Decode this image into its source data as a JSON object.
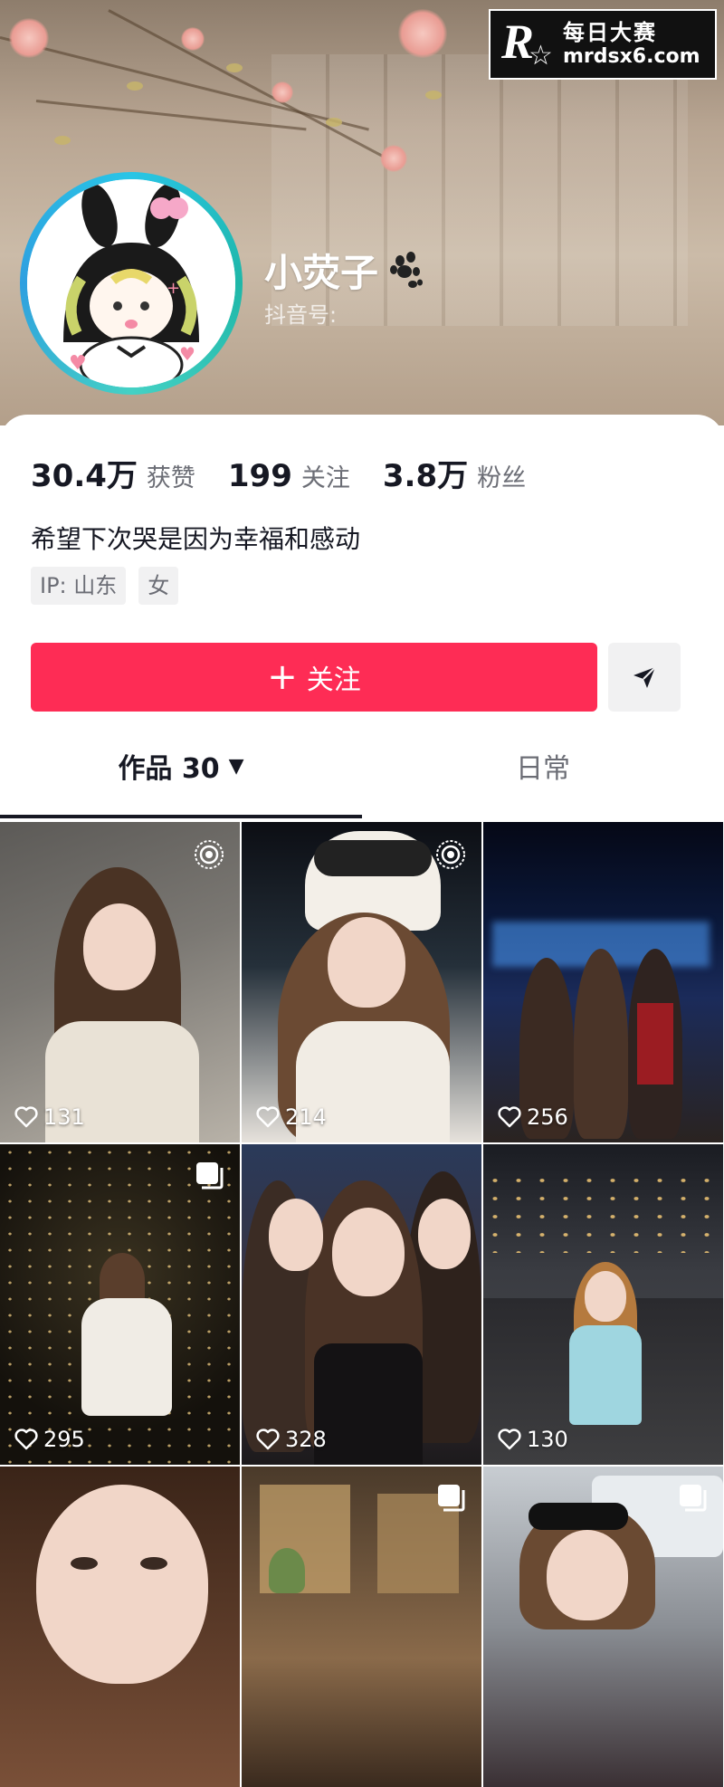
{
  "watermark": {
    "title": "每日大赛",
    "url": "mrdsx6.com"
  },
  "profile": {
    "name": "小荧子",
    "douyin_id_label": "抖音号:",
    "stats": [
      {
        "value": "30.4万",
        "label": "获赞"
      },
      {
        "value": "199",
        "label": "关注"
      },
      {
        "value": "3.8万",
        "label": "粉丝"
      }
    ],
    "bio": "希望下次哭是因为幸福和感动",
    "tags": [
      "IP: 山东",
      "女"
    ]
  },
  "actions": {
    "follow_label": "关注"
  },
  "tabs": {
    "works_label": "作品 30",
    "daily_label": "日常"
  },
  "videos": [
    {
      "likes": "131",
      "badge": "live-icon"
    },
    {
      "likes": "214",
      "badge": "live-icon"
    },
    {
      "likes": "256",
      "badge": ""
    },
    {
      "likes": "295",
      "badge": "multi-image-icon"
    },
    {
      "likes": "328",
      "badge": ""
    },
    {
      "likes": "130",
      "badge": ""
    },
    {
      "likes": "",
      "badge": ""
    },
    {
      "likes": "",
      "badge": "multi-image-icon"
    },
    {
      "likes": "",
      "badge": "multi-image-icon"
    }
  ],
  "colors": {
    "accent": "#fe2c55",
    "text": "#161823",
    "muted": "#6b6d75"
  }
}
